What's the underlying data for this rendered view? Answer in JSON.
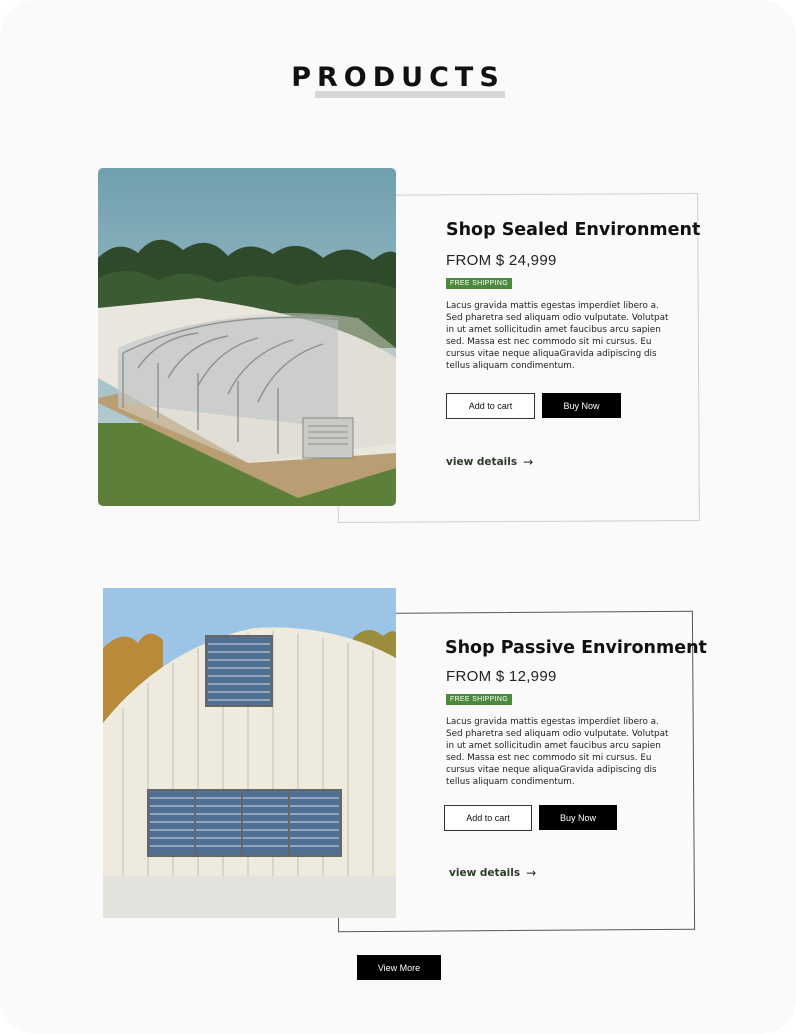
{
  "section": {
    "title": "PRODUCTS"
  },
  "products": [
    {
      "name": "Shop Sealed Environment",
      "price": "FROM $ 24,999",
      "badge": "FREE SHIPPING",
      "description": "Lacus gravida mattis egestas imperdiet libero a. Sed pharetra sed aliquam odio vulputate. Volutpat in ut amet sollicitudin amet faucibus arcu sapien sed. Massa est nec commodo sit mi cursus. Eu cursus vitae neque aliquaGravida adipiscing dis tellus aliquam condimentum.",
      "add_to_cart": "Add to cart",
      "buy_now": "Buy Now",
      "view_details": "view details",
      "image_alt": "sealed greenhouse"
    },
    {
      "name": "Shop Passive Environment",
      "price": "FROM $ 12,999",
      "badge": "FREE SHIPPING",
      "description": "Lacus gravida mattis egestas imperdiet libero a. Sed pharetra sed aliquam odio vulputate. Volutpat in ut amet sollicitudin amet faucibus arcu sapien sed. Massa est nec commodo sit mi cursus. Eu cursus vitae neque aliquaGravida adipiscing dis tellus aliquam condimentum.",
      "add_to_cart": "Add to cart",
      "buy_now": "Buy Now",
      "view_details": "view details",
      "image_alt": "passive greenhouse"
    }
  ],
  "view_more": "View More",
  "colors": {
    "badge": "#4b8a3c",
    "button": "#000000",
    "page_bg": "#fafafa"
  },
  "icons": {
    "details_arrow": "arrow-right-icon"
  }
}
